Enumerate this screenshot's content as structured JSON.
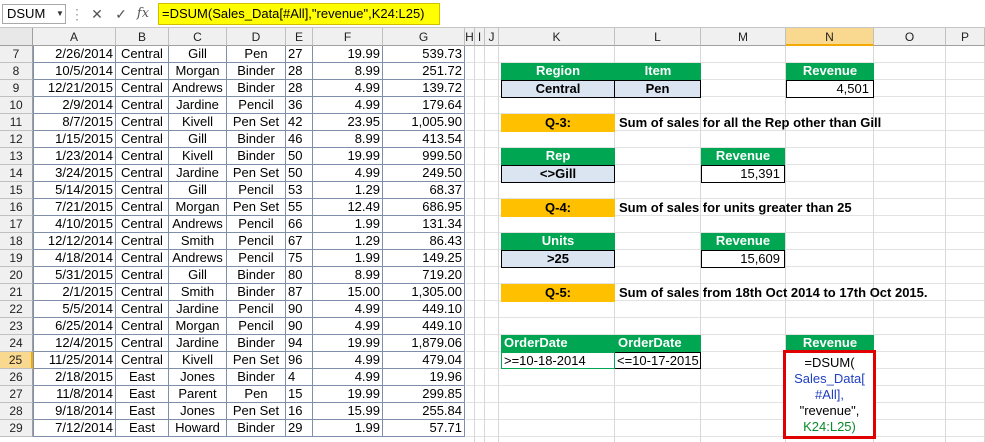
{
  "formula_bar": {
    "name_box": "DSUM",
    "cancel_icon": "✕",
    "enter_icon": "✓",
    "fx_label": "fx",
    "formula": "=DSUM(Sales_Data[#All],\"revenue\",K24:L25)"
  },
  "columns": [
    "A",
    "B",
    "C",
    "D",
    "E",
    "F",
    "G",
    "H",
    "I",
    "J",
    "K",
    "L",
    "M",
    "N",
    "O",
    "P"
  ],
  "selected_column": "N",
  "selected_row": "25",
  "rows": [
    {
      "n": "7",
      "date": "2/26/2014",
      "region": "Central",
      "rep": "Gill",
      "item": "Pen",
      "units": "27",
      "price": "19.99",
      "total": "539.73"
    },
    {
      "n": "8",
      "date": "10/5/2014",
      "region": "Central",
      "rep": "Morgan",
      "item": "Binder",
      "units": "28",
      "price": "8.99",
      "total": "251.72"
    },
    {
      "n": "9",
      "date": "12/21/2015",
      "region": "Central",
      "rep": "Andrews",
      "item": "Binder",
      "units": "28",
      "price": "4.99",
      "total": "139.72"
    },
    {
      "n": "10",
      "date": "2/9/2014",
      "region": "Central",
      "rep": "Jardine",
      "item": "Pencil",
      "units": "36",
      "price": "4.99",
      "total": "179.64"
    },
    {
      "n": "11",
      "date": "8/7/2015",
      "region": "Central",
      "rep": "Kivell",
      "item": "Pen Set",
      "units": "42",
      "price": "23.95",
      "total": "1,005.90"
    },
    {
      "n": "12",
      "date": "1/15/2015",
      "region": "Central",
      "rep": "Gill",
      "item": "Binder",
      "units": "46",
      "price": "8.99",
      "total": "413.54"
    },
    {
      "n": "13",
      "date": "1/23/2014",
      "region": "Central",
      "rep": "Kivell",
      "item": "Binder",
      "units": "50",
      "price": "19.99",
      "total": "999.50"
    },
    {
      "n": "14",
      "date": "3/24/2015",
      "region": "Central",
      "rep": "Jardine",
      "item": "Pen Set",
      "units": "50",
      "price": "4.99",
      "total": "249.50"
    },
    {
      "n": "15",
      "date": "5/14/2015",
      "region": "Central",
      "rep": "Gill",
      "item": "Pencil",
      "units": "53",
      "price": "1.29",
      "total": "68.37"
    },
    {
      "n": "16",
      "date": "7/21/2015",
      "region": "Central",
      "rep": "Morgan",
      "item": "Pen Set",
      "units": "55",
      "price": "12.49",
      "total": "686.95"
    },
    {
      "n": "17",
      "date": "4/10/2015",
      "region": "Central",
      "rep": "Andrews",
      "item": "Pencil",
      "units": "66",
      "price": "1.99",
      "total": "131.34"
    },
    {
      "n": "18",
      "date": "12/12/2014",
      "region": "Central",
      "rep": "Smith",
      "item": "Pencil",
      "units": "67",
      "price": "1.29",
      "total": "86.43"
    },
    {
      "n": "19",
      "date": "4/18/2014",
      "region": "Central",
      "rep": "Andrews",
      "item": "Pencil",
      "units": "75",
      "price": "1.99",
      "total": "149.25"
    },
    {
      "n": "20",
      "date": "5/31/2015",
      "region": "Central",
      "rep": "Gill",
      "item": "Binder",
      "units": "80",
      "price": "8.99",
      "total": "719.20"
    },
    {
      "n": "21",
      "date": "2/1/2015",
      "region": "Central",
      "rep": "Smith",
      "item": "Binder",
      "units": "87",
      "price": "15.00",
      "total": "1,305.00"
    },
    {
      "n": "22",
      "date": "5/5/2014",
      "region": "Central",
      "rep": "Jardine",
      "item": "Pencil",
      "units": "90",
      "price": "4.99",
      "total": "449.10"
    },
    {
      "n": "23",
      "date": "6/25/2014",
      "region": "Central",
      "rep": "Morgan",
      "item": "Pencil",
      "units": "90",
      "price": "4.99",
      "total": "449.10"
    },
    {
      "n": "24",
      "date": "12/4/2015",
      "region": "Central",
      "rep": "Jardine",
      "item": "Binder",
      "units": "94",
      "price": "19.99",
      "total": "1,879.06"
    },
    {
      "n": "25",
      "date": "11/25/2014",
      "region": "Central",
      "rep": "Kivell",
      "item": "Pen Set",
      "units": "96",
      "price": "4.99",
      "total": "479.04"
    },
    {
      "n": "26",
      "date": "2/18/2015",
      "region": "East",
      "rep": "Jones",
      "item": "Binder",
      "units": "4",
      "price": "4.99",
      "total": "19.96"
    },
    {
      "n": "27",
      "date": "11/8/2014",
      "region": "East",
      "rep": "Parent",
      "item": "Pen",
      "units": "15",
      "price": "19.99",
      "total": "299.85"
    },
    {
      "n": "28",
      "date": "9/18/2014",
      "region": "East",
      "rep": "Jones",
      "item": "Pen Set",
      "units": "16",
      "price": "15.99",
      "total": "255.84"
    },
    {
      "n": "29",
      "date": "7/12/2014",
      "region": "East",
      "rep": "Howard",
      "item": "Binder",
      "units": "29",
      "price": "1.99",
      "total": "57.71"
    }
  ],
  "q2": {
    "region_header": "Region",
    "item_header": "Item",
    "region_value": "Central",
    "item_value": "Pen",
    "revenue_header": "Revenue",
    "revenue_value": "4,501"
  },
  "q3": {
    "label": "Q-3:",
    "text": "Sum of sales for all the Rep other than Gill",
    "crit_header": "Rep",
    "crit_value": "<>Gill",
    "revenue_header": "Revenue",
    "revenue_value": "15,391"
  },
  "q4": {
    "label": "Q-4:",
    "text": "Sum of sales for units greater than 25",
    "crit_header": "Units",
    "crit_value": ">25",
    "revenue_header": "Revenue",
    "revenue_value": "15,609"
  },
  "q5": {
    "label": "Q-5:",
    "text": "Sum of sales from 18th Oct 2014 to 17th Oct 2015.",
    "crit_header_1": "OrderDate",
    "crit_header_2": "OrderDate",
    "crit_value_1": ">=10-18-2014",
    "crit_value_2": "<=10-17-2015",
    "revenue_header": "Revenue",
    "edit_line1": "=DSUM(",
    "edit_line2": "Sales_Data[",
    "edit_line3": "#All],",
    "edit_line4": "\"revenue\",",
    "edit_line5": "K24:L25)"
  },
  "colors": {
    "header_green": "#00a651",
    "question_orange": "#ffc000",
    "formula_yellow": "#ffff00",
    "edit_red": "#e00000",
    "criteria_blue": "#dbe5f1"
  }
}
